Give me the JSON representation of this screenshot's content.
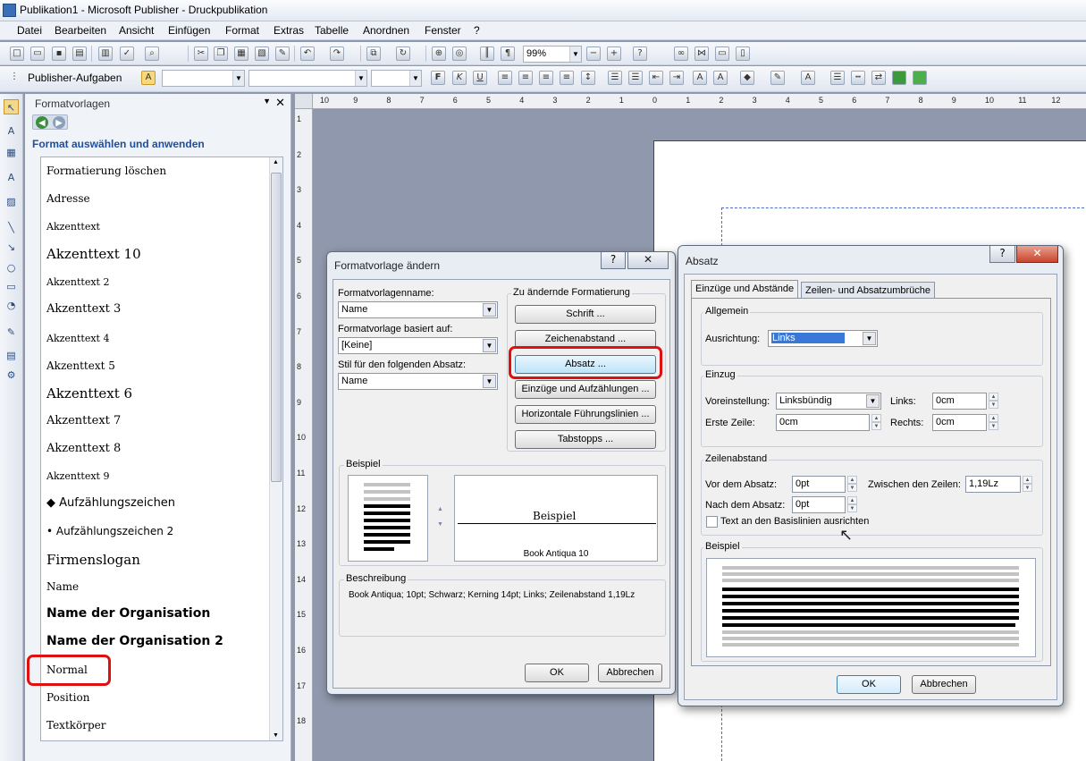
{
  "window": {
    "title": "Publikation1 - Microsoft Publisher - Druckpublikation"
  },
  "menu": [
    "Datei",
    "Bearbeiten",
    "Ansicht",
    "Einfügen",
    "Format",
    "Extras",
    "Tabelle",
    "Anordnen",
    "Fenster",
    "?"
  ],
  "toolbar": {
    "zoom": "99%",
    "task_button": "Publisher-Aufgaben"
  },
  "pane": {
    "title": "Formatvorlagen",
    "heading": "Format auswählen und anwenden",
    "styles": [
      {
        "label": "Formatierung löschen"
      },
      {
        "label": "Adresse"
      },
      {
        "label": "Akzenttext"
      },
      {
        "label": "Akzenttext 10"
      },
      {
        "label": "Akzenttext 2"
      },
      {
        "label": "Akzenttext 3"
      },
      {
        "label": "Akzenttext 4"
      },
      {
        "label": "Akzenttext 5"
      },
      {
        "label": "Akzenttext 6"
      },
      {
        "label": "Akzenttext 7"
      },
      {
        "label": "Akzenttext 8"
      },
      {
        "label": "Akzenttext 9"
      },
      {
        "label": "◆  Aufzählungszeichen"
      },
      {
        "label": "•  Aufzählungszeichen 2"
      },
      {
        "label": "Firmenslogan"
      },
      {
        "label": "Name"
      },
      {
        "label": "Name der Organisation"
      },
      {
        "label": "Name der Organisation 2"
      },
      {
        "label": "Normal"
      },
      {
        "label": "Position"
      },
      {
        "label": "Textkörper"
      }
    ]
  },
  "ruler": {
    "h": [
      "10",
      "9",
      "8",
      "7",
      "6",
      "5",
      "4",
      "3",
      "2",
      "1",
      "0",
      "1",
      "2",
      "3",
      "4",
      "5",
      "6",
      "7",
      "8",
      "9",
      "10",
      "11",
      "12"
    ],
    "v": [
      "1",
      "2",
      "3",
      "4",
      "5",
      "6",
      "7",
      "8",
      "9",
      "10",
      "11",
      "12",
      "13",
      "14",
      "15",
      "16",
      "17",
      "18"
    ]
  },
  "dlg1": {
    "title": "Formatvorlage ändern",
    "name_label": "Formatvorlagenname:",
    "name_value": "Name",
    "based_label": "Formatvorlage basiert auf:",
    "based_value": "[Keine]",
    "next_label": "Stil für den folgenden Absatz:",
    "next_value": "Name",
    "change_label": "Zu ändernde Formatierung",
    "buttons": [
      "Schrift ...",
      "Zeichenabstand ...",
      "Absatz ...",
      "Einzüge und Aufzählungen ...",
      "Horizontale Führungslinien ...",
      "Tabstopps ..."
    ],
    "example_label": "Beispiel",
    "example_text": "Beispiel",
    "example_font": "Book Antiqua 10",
    "desc_label": "Beschreibung",
    "desc_text": "Book Antiqua; 10pt;  Schwarz;  Kerning 14pt; Links; Zeilenabstand 1,19Lz",
    "ok": "OK",
    "cancel": "Abbrechen"
  },
  "dlg2": {
    "title": "Absatz",
    "tab1": "Einzüge und Abstände",
    "tab2": "Zeilen- und Absatzumbrüche",
    "general": "Allgemein",
    "align_label": "Ausrichtung:",
    "align_value": "Links",
    "indent": "Einzug",
    "preset_label": "Voreinstellung:",
    "preset_value": "Linksbündig",
    "left_label": "Links:",
    "left_value": "0cm",
    "first_label": "Erste Zeile:",
    "first_value": "0cm",
    "right_label": "Rechts:",
    "right_value": "0cm",
    "spacing": "Zeilenabstand",
    "before_label": "Vor dem Absatz:",
    "before_value": "0pt",
    "between_label": "Zwischen den Zeilen:",
    "between_value": "1,19Lz",
    "after_label": "Nach dem Absatz:",
    "after_value": "0pt",
    "baseline_label": "Text an den Basislinien ausrichten",
    "example_label": "Beispiel",
    "ok": "OK",
    "cancel": "Abbrechen"
  },
  "colors": {
    "highlight": "#e01010",
    "accent": "#1f4e9c"
  }
}
